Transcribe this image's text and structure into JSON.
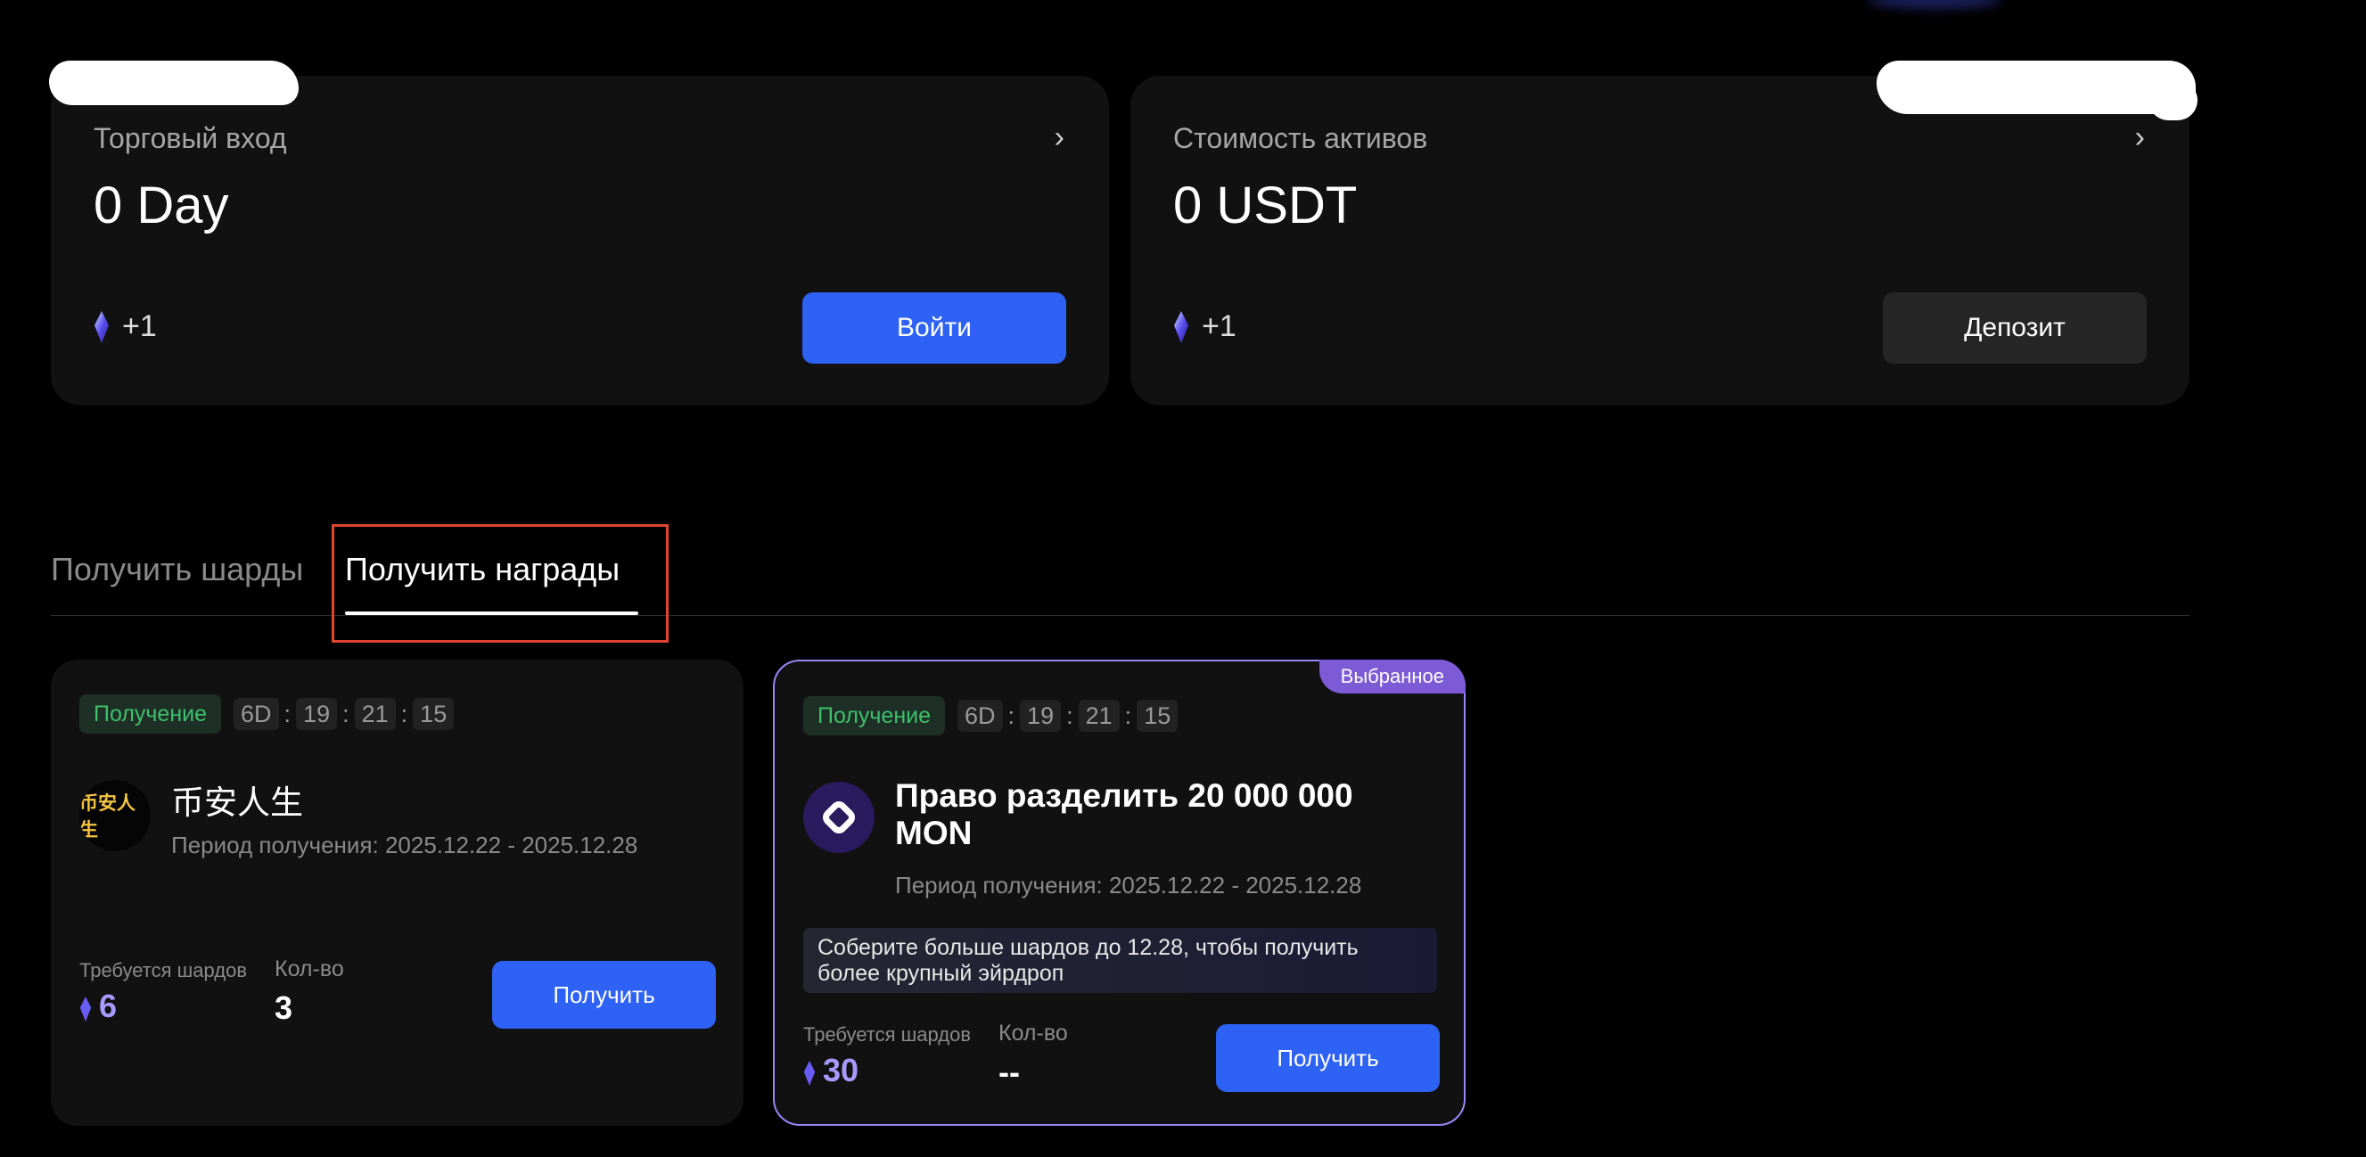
{
  "top_cards": [
    {
      "title": "Торговый вход",
      "value": "0 Day",
      "bonus": "+1",
      "button": "Войти"
    },
    {
      "title": "Стоимость активов",
      "value": "0 USDT",
      "bonus": "+1",
      "button": "Депозит"
    }
  ],
  "tabs": {
    "get_shards": "Получить шарды",
    "get_rewards": "Получить награды",
    "active": "get_rewards"
  },
  "rewards": [
    {
      "status": "Получение",
      "timer": {
        "d": "6D",
        "h": "19",
        "m": "21",
        "s": "15"
      },
      "logo_text": "币安人生",
      "name": "币安人生",
      "period": "Период получения: 2025.12.22 - 2025.12.28",
      "shards_label": "Требуется шардов",
      "shards_value": "6",
      "qty_label": "Кол-во",
      "qty_value": "3",
      "button": "Получить"
    },
    {
      "featured": "Выбранное",
      "status": "Получение",
      "timer": {
        "d": "6D",
        "h": "19",
        "m": "21",
        "s": "15"
      },
      "name": "Право разделить 20 000 000 MON",
      "period": "Период получения: 2025.12.22 - 2025.12.28",
      "notice": "Соберите больше шардов до 12.28, чтобы получить более крупный эйрдроп",
      "shards_label": "Требуется шардов",
      "shards_value": "30",
      "qty_label": "Кол-во",
      "qty_value": "--",
      "button": "Получить"
    }
  ],
  "colors": {
    "accent": "#2e62f5",
    "status_green": "#3fbf6d",
    "featured_purple": "#7d5ad6",
    "shard_purple": "#a79bff",
    "highlight": "#e04530"
  }
}
